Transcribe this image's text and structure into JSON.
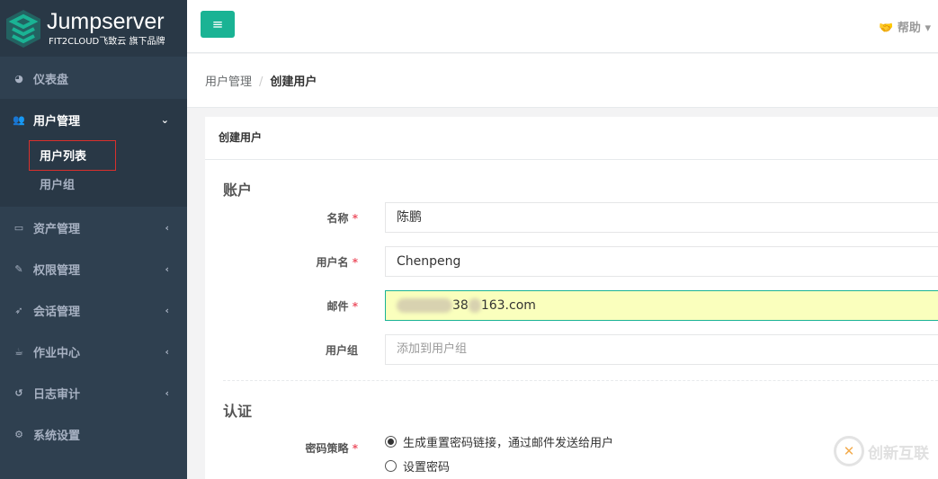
{
  "brand": {
    "name": "Jumpserver",
    "tagline": "FIT2CLOUD飞致云 旗下品牌"
  },
  "sidebar": {
    "dashboard": "仪表盘",
    "users": {
      "label": "用户管理",
      "children": [
        "用户列表",
        "用户组"
      ]
    },
    "items": [
      "资产管理",
      "权限管理",
      "会话管理",
      "作业中心",
      "日志审计",
      "系统设置"
    ]
  },
  "header": {
    "menu_icon": "≡",
    "help": "帮助"
  },
  "breadcrumb": [
    "用户管理",
    "创建用户"
  ],
  "form": {
    "title": "创建用户",
    "section_account": "账户",
    "name_label": "名称",
    "name_value": "陈鹏",
    "username_label": "用户名",
    "username_value": "Chenpeng",
    "email_label": "邮件",
    "email_visible_1": "38",
    "email_visible_2": "163.com",
    "group_label": "用户组",
    "group_placeholder": "添加到用户组",
    "section_auth": "认证",
    "pwd_label": "密码策略",
    "pwd_options": [
      "生成重置密码链接，通过邮件发送给用户",
      "设置密码"
    ],
    "required_mark": "*"
  },
  "watermark": "创新互联"
}
